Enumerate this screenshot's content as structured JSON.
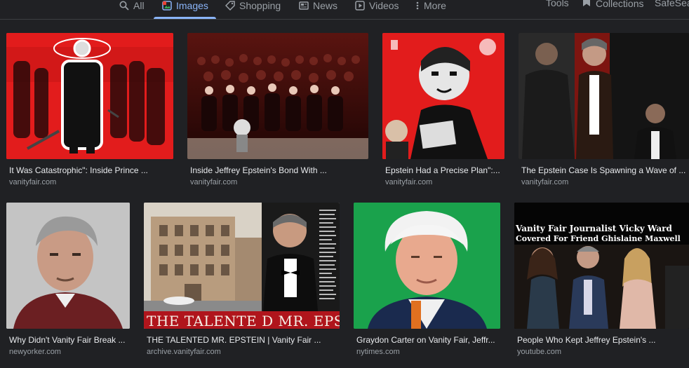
{
  "tabs": [
    {
      "label": "All",
      "icon": "search-icon"
    },
    {
      "label": "Images",
      "icon": "image-icon"
    },
    {
      "label": "Shopping",
      "icon": "tag-icon"
    },
    {
      "label": "News",
      "icon": "newspaper-icon"
    },
    {
      "label": "Videos",
      "icon": "play-icon"
    },
    {
      "label": "More",
      "icon": "more-vertical-icon"
    }
  ],
  "toolbar": {
    "tools_label": "Tools",
    "collections_label": "Collections",
    "safesearch_label": "SafeSear"
  },
  "results": [
    {
      "title": "It Was Catastrophic\": Inside Prince ...",
      "source": "vanityfair.com"
    },
    {
      "title": "Inside Jeffrey Epstein's Bond With ...",
      "source": "vanityfair.com"
    },
    {
      "title": "Epstein Had a Precise Plan\":...",
      "source": "vanityfair.com"
    },
    {
      "title": "The Epstein Case Is Spawning a Wave of ...",
      "source": "vanityfair.com"
    },
    {
      "title": "Why Didn't Vanity Fair Break ...",
      "source": "newyorker.com"
    },
    {
      "title": "THE TALENTED MR. EPSTEIN | Vanity Fair ...",
      "source": "archive.vanityfair.com"
    },
    {
      "title": "Graydon Carter on Vanity Fair, Jeffr...",
      "source": "nytimes.com"
    },
    {
      "title": "People Who Kept Jeffrey Epstein's ...",
      "source": "youtube.com"
    }
  ],
  "image_text": {
    "talented_banner": "THE TALENTE D MR. EPSTEIN",
    "vf_headline_line1": "Vanity Fair Journalist Vicky Ward",
    "vf_headline_line2": "Covered For Friend Ghislaine Maxwell"
  },
  "colors": {
    "background": "#202124",
    "accent": "#8ab4f8",
    "muted": "#9aa0a6"
  }
}
